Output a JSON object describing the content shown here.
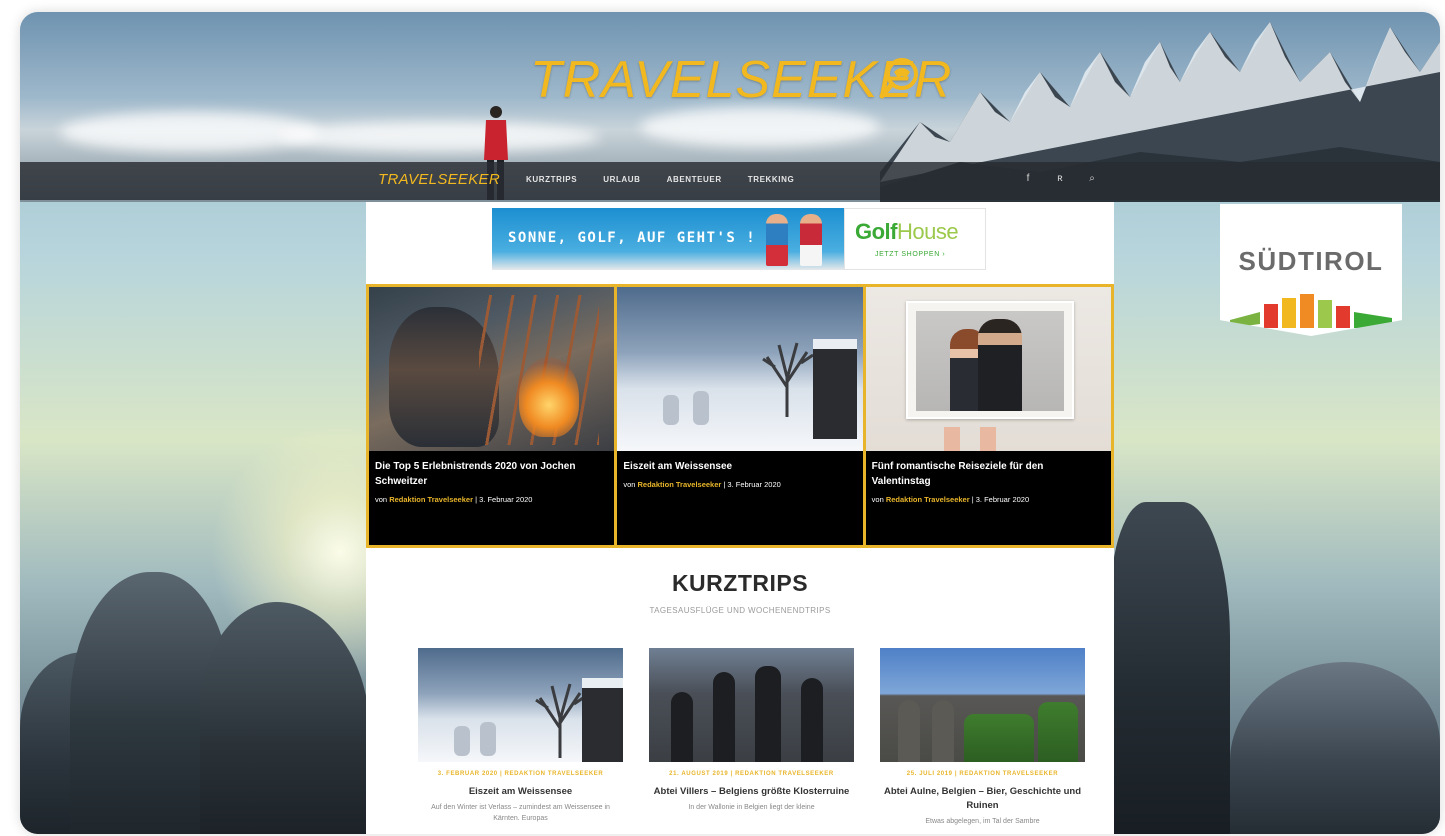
{
  "header": {
    "logo": "TRAVELSEEKER",
    "nav_logo": "TRAVELSEEKER",
    "nav_items": [
      "KURZTRIPS",
      "URLAUB",
      "ABENTEUER",
      "TREKKING"
    ],
    "icons": [
      "facebook-icon",
      "rss-icon",
      "search-icon"
    ],
    "icon_glyphs": [
      "f",
      "ʀ",
      "⌕"
    ]
  },
  "ad_banner": {
    "slogan": "SONNE, GOLF, AUF GEHT'S !",
    "brand_main": "Golf",
    "brand_sub": "House",
    "cta": "JETZT SHOPPEN ›"
  },
  "featured": [
    {
      "title": "Die Top 5 Erlebnistrends 2020 von Jochen Schweitzer",
      "by": "von",
      "author": "Redaktion Travelseeker",
      "date": " | 3. Februar 2020"
    },
    {
      "title": "Eiszeit am Weissensee",
      "by": "von",
      "author": "Redaktion Travelseeker",
      "date": " | 3. Februar 2020"
    },
    {
      "title": "Fünf romantische Reiseziele für den Valentinstag",
      "by": "von",
      "author": "Redaktion Travelseeker",
      "date": " | 3. Februar 2020"
    }
  ],
  "section": {
    "title": "KURZTRIPS",
    "subtitle": "TAGESAUSFLÜGE UND WOCHENENDTRIPS"
  },
  "trips": [
    {
      "meta": "3. FEBRUAR 2020 | REDAKTION TRAVELSEEKER",
      "title": "Eiszeit am Weissensee",
      "excerpt": "Auf den Winter ist Verlass – zumindest am Weissensee in Kärnten. Europas"
    },
    {
      "meta": "21. AUGUST 2019 | REDAKTION TRAVELSEEKER",
      "title": "Abtei Villers – Belgiens größte Klosterruine",
      "excerpt": "In der Wallonie in Belgien liegt der kleine"
    },
    {
      "meta": "25. JULI 2019 | REDAKTION TRAVELSEEKER",
      "title": "Abtei Aulne, Belgien – Bier, Geschichte und Ruinen",
      "excerpt": "Etwas abgelegen, im Tal der Sambre"
    }
  ],
  "side_ad": {
    "text": "SÜDTIROL"
  }
}
